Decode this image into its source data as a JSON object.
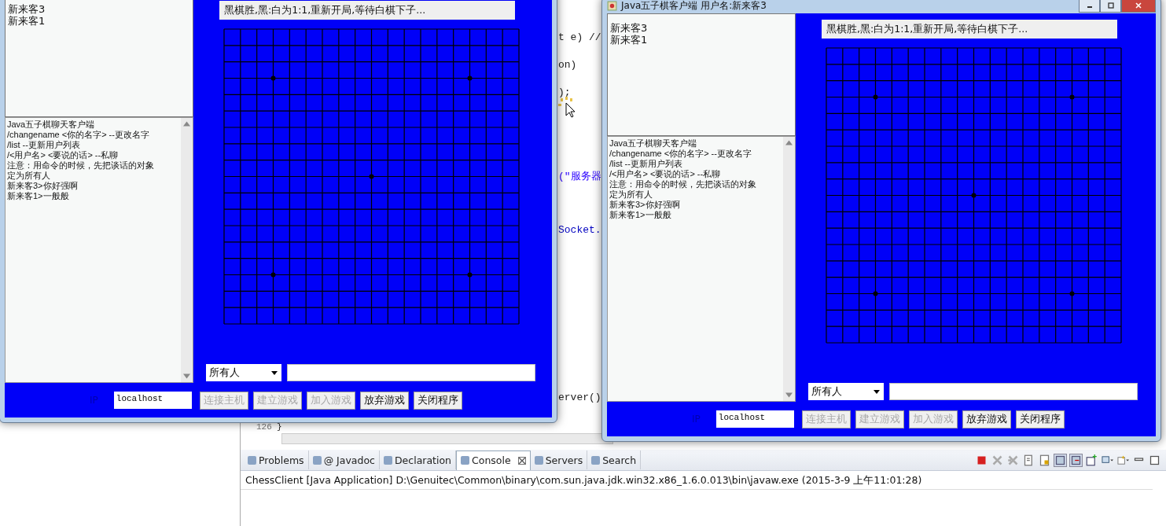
{
  "editor": {
    "code_lines": [
      {
        "text": "t e) //",
        "kind": "code"
      },
      {
        "text": "on)",
        "kind": "code"
      },
      {
        "text": ");",
        "kind": "code"
      },
      {
        "text": "(\"服务器",
        "kind": "string"
      },
      {
        "text": "Socket.",
        "kind": "field"
      },
      {
        "text": "erver()",
        "kind": "code"
      }
    ],
    "line_number": "126",
    "last_line": "}"
  },
  "windows": [
    {
      "users": [
        "新来客3",
        "新来客1"
      ],
      "chat": [
        "Java五子棋聊天客户端",
        "/changename <你的名字> --更改名字",
        "/list --更新用户列表",
        "/<用户名> <要说的话> --私聊",
        "注意：用命令的时候，先把谈话的对象定为所有人",
        "新来客3>你好强啊",
        "新来客1>一般般"
      ],
      "status": "黑棋胜,黑:白为1:1,重新开局,等待白棋下子...",
      "target": "所有人",
      "ip_label": "IP",
      "ip": "localhost",
      "buttons": [
        {
          "label": "连接主机",
          "disabled": true
        },
        {
          "label": "建立游戏",
          "disabled": true
        },
        {
          "label": "加入游戏",
          "disabled": true
        },
        {
          "label": "放弃游戏",
          "disabled": false
        },
        {
          "label": "关闭程序",
          "disabled": false
        }
      ]
    },
    {
      "title": "Java五子棋客户端 用户名:新来客3",
      "users": [
        "新来客3",
        "新来客1"
      ],
      "chat": [
        "Java五子棋聊天客户端",
        "/changename <你的名字> --更改名字",
        "/list --更新用户列表",
        "/<用户名> <要说的话> --私聊",
        "注意：用命令的时候，先把谈话的对象定为所有人",
        "新来客3>你好强啊",
        "新来客1>一般般"
      ],
      "status": "黑棋胜,黑:白为1:1,重新开局,等待白棋下子...",
      "target": "所有人",
      "ip_label": "IP",
      "ip": "localhost",
      "buttons": [
        {
          "label": "连接主机",
          "disabled": true
        },
        {
          "label": "建立游戏",
          "disabled": true
        },
        {
          "label": "加入游戏",
          "disabled": true
        },
        {
          "label": "放弃游戏",
          "disabled": false
        },
        {
          "label": "关闭程序",
          "disabled": false
        }
      ]
    }
  ],
  "views": {
    "tabs": [
      {
        "label": "Problems",
        "selected": false
      },
      {
        "label": "@ Javadoc",
        "selected": false
      },
      {
        "label": "Declaration",
        "selected": false
      },
      {
        "label": "Console",
        "selected": true
      },
      {
        "label": "Servers",
        "selected": false
      },
      {
        "label": "Search",
        "selected": false
      }
    ],
    "console_header": "ChessClient [Java Application] D:\\Genuitec\\Common\\binary\\com.sun.java.jdk.win32.x86_1.6.0.013\\bin\\javaw.exe (2015-3-9 上午11:01:28)"
  }
}
